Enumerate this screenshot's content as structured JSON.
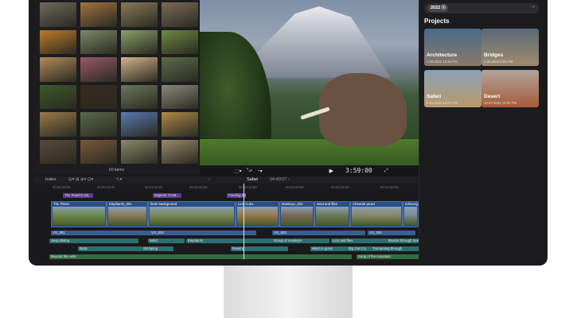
{
  "browser": {
    "item_count": "60 items",
    "thumbnails": [
      {
        "name": "rhino-thumb",
        "color": "#6e6a5e"
      },
      {
        "name": "giraffe-thumb",
        "color": "#a0733e"
      },
      {
        "name": "lion-thumb",
        "color": "#8a7a5a"
      },
      {
        "name": "monkey-thumb",
        "color": "#7d6d55"
      },
      {
        "name": "sunset-thumb",
        "color": "#c07a2a"
      },
      {
        "name": "elephant-thumb",
        "color": "#7b8a6a"
      },
      {
        "name": "herd-thumb",
        "color": "#8aa06a"
      },
      {
        "name": "bird-thumb",
        "color": "#6e8a40"
      },
      {
        "name": "road-thumb",
        "color": "#b48a5a"
      },
      {
        "name": "dusk-thumb",
        "color": "#9a5a6a"
      },
      {
        "name": "tree-silhouette-thumb",
        "color": "#d2b48a"
      },
      {
        "name": "jeep-thumb",
        "color": "#5a6e4a"
      },
      {
        "name": "tree-thumb",
        "color": "#3e5a2a"
      },
      {
        "name": "night-sunset-thumb",
        "color": "#3a2a1a"
      },
      {
        "name": "buffalo-thumb",
        "color": "#6a7a5a"
      },
      {
        "name": "zebra-thumb",
        "color": "#8a8a7a"
      },
      {
        "name": "lioness-thumb",
        "color": "#9a7a4a"
      },
      {
        "name": "wildebeest-thumb",
        "color": "#5a6a4a"
      },
      {
        "name": "giraffe-sky-thumb",
        "color": "#5a7ab0"
      },
      {
        "name": "giraffe-pair-thumb",
        "color": "#b08a4a"
      },
      {
        "name": "hut-thumb",
        "color": "#5a4a3a"
      },
      {
        "name": "basket-thumb",
        "color": "#7a5a3a"
      },
      {
        "name": "acacia-thumb",
        "color": "#8a8a6a"
      },
      {
        "name": "safari-truck-thumb",
        "color": "#9a8a6a"
      }
    ]
  },
  "viewer": {
    "timecode": "3:59:00",
    "zoom_icons": [
      "crop-icon",
      "transform-icon",
      "speed-icon"
    ]
  },
  "search": {
    "token": "2022"
  },
  "projects": {
    "title": "Projects",
    "cards": [
      {
        "name": "Architecture",
        "date": "1.09.2022 10:45 PM",
        "color_a": "#4a6a8a",
        "color_b": "#8a7a6a"
      },
      {
        "name": "Bridges",
        "date": "4.05.2022 6:55 PM",
        "color_a": "#5a6a7a",
        "color_b": "#a08a6a"
      },
      {
        "name": "Safari",
        "date": "6.01.2022 12:00 PM",
        "color_a": "#8aa0b8",
        "color_b": "#b89a6a"
      },
      {
        "name": "Desert",
        "date": "10.07.2022 12:00 PM",
        "color_a": "#b0a49a",
        "color_b": "#a85a3a"
      }
    ]
  },
  "timeline": {
    "index_label": "Index",
    "project_name": "Safari",
    "duration": "04:40:07",
    "ruler": [
      "00:00:00:00",
      "00:00:15:00",
      "00:01:00:00",
      "00:02:00:00",
      "00:02:15:00",
      "00:03:00:00",
      "00:03:15:00",
      "00:04:00:00"
    ],
    "top_clips": [
      {
        "label": "The Road to Sa...",
        "cls": "purple"
      },
      {
        "label": "Majestic Creat...",
        "cls": "purple"
      },
      {
        "label": "Feeding time I...",
        "cls": "purple"
      }
    ],
    "primary": [
      {
        "label": "The Plains",
        "color": "#6a8a4a"
      },
      {
        "label": "Elephants_001",
        "color": "#8a7a5a"
      },
      {
        "label": "birds background",
        "color": "#7a8a5a"
      },
      {
        "label": "Lion Cubs",
        "color": "#9a7a4a"
      },
      {
        "label": "Monkeys_001",
        "color": "#7a6a5a"
      },
      {
        "label": "wind and flies",
        "color": "#6a7a5a"
      },
      {
        "label": "Cheetah prowl",
        "color": "#8a8a6a"
      },
      {
        "label": "Kilimanjaro",
        "color": "#7a8a9a"
      }
    ],
    "audio_rows": [
      [
        {
          "label": "VO_001",
          "cls": "blue"
        },
        {
          "label": "VO_003",
          "cls": "blue"
        },
        {
          "label": "VO_003",
          "cls": "blue"
        },
        {
          "label": "VO_004",
          "cls": "blue"
        }
      ],
      [
        {
          "label": "Jeep driving",
          "cls": "teal"
        },
        {
          "label": "Wind",
          "cls": "teal"
        },
        {
          "label": "Elephants",
          "cls": "teal"
        },
        {
          "label": "Group of monkeys",
          "cls": "teal"
        },
        {
          "label": "Lion and flies",
          "cls": "teal"
        },
        {
          "label": "Breeze through trees",
          "cls": "teal"
        }
      ],
      [
        {
          "label": "Birds",
          "cls": "teal"
        },
        {
          "label": "Stomping",
          "cls": "teal"
        },
        {
          "label": "Roaring",
          "cls": "teal"
        },
        {
          "label": "Wind in grass",
          "cls": "teal"
        },
        {
          "label": "Big Cat Cry",
          "cls": "teal"
        },
        {
          "label": "Trumpeting through",
          "cls": "teal"
        }
      ],
      [
        {
          "label": "Beyond the veils",
          "cls": "green"
        },
        {
          "label": "Song of the mountain",
          "cls": "green"
        }
      ]
    ]
  }
}
